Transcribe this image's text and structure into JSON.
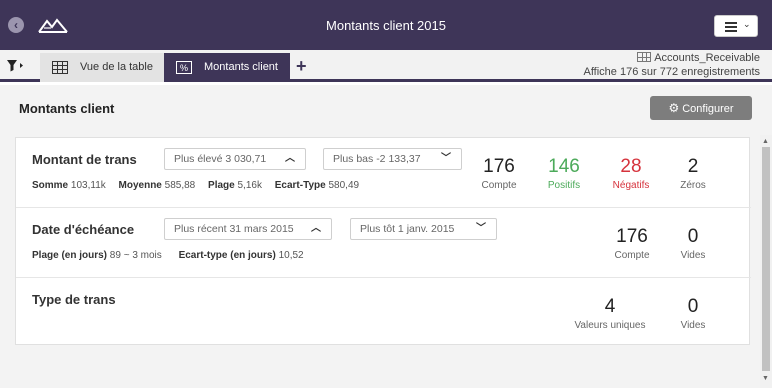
{
  "window": {
    "title": "Montants client 2015"
  },
  "tabs": {
    "table_label": "Vue de la table",
    "amounts_label": "Montants client",
    "add_label": "+"
  },
  "source": {
    "name": "Accounts_Receivable",
    "summary": "Affiche 176 sur 772 enregistrements"
  },
  "panel": {
    "title": "Montants client",
    "configure_label": "Configurer"
  },
  "rows": [
    {
      "title": "Montant de trans",
      "high": "Plus élevé 3 030,71",
      "low": "Plus bas -2 133,37",
      "stats": [
        {
          "label": "Somme",
          "value": "103,11k"
        },
        {
          "label": "Moyenne",
          "value": "585,88"
        },
        {
          "label": "Plage",
          "value": "5,16k"
        },
        {
          "label": "Ecart-Type",
          "value": "580,49"
        }
      ],
      "metrics": [
        {
          "value": "176",
          "label": "Compte"
        },
        {
          "value": "146",
          "label": "Positifs"
        },
        {
          "value": "28",
          "label": "Négatifs"
        },
        {
          "value": "2",
          "label": "Zéros"
        }
      ]
    },
    {
      "title": "Date d'échéance",
      "high": "Plus récent 31 mars 2015",
      "low": "Plus tôt 1 janv. 2015",
      "stats": [
        {
          "label": "Plage (en jours)",
          "value": "89 ~ 3 mois"
        },
        {
          "label": "Ecart-type (en jours)",
          "value": "10,52"
        }
      ],
      "metrics": [
        {
          "value": "176",
          "label": "Compte"
        },
        {
          "value": "0",
          "label": "Vides"
        }
      ]
    },
    {
      "title": "Type de trans",
      "metrics": [
        {
          "value": "4",
          "label": "Valeurs uniques"
        },
        {
          "value": "0",
          "label": "Vides"
        }
      ]
    }
  ],
  "colors": {
    "header": "#3e3558",
    "positive": "#4caa5a",
    "negative": "#d6333d",
    "button": "#7d7d7d"
  }
}
